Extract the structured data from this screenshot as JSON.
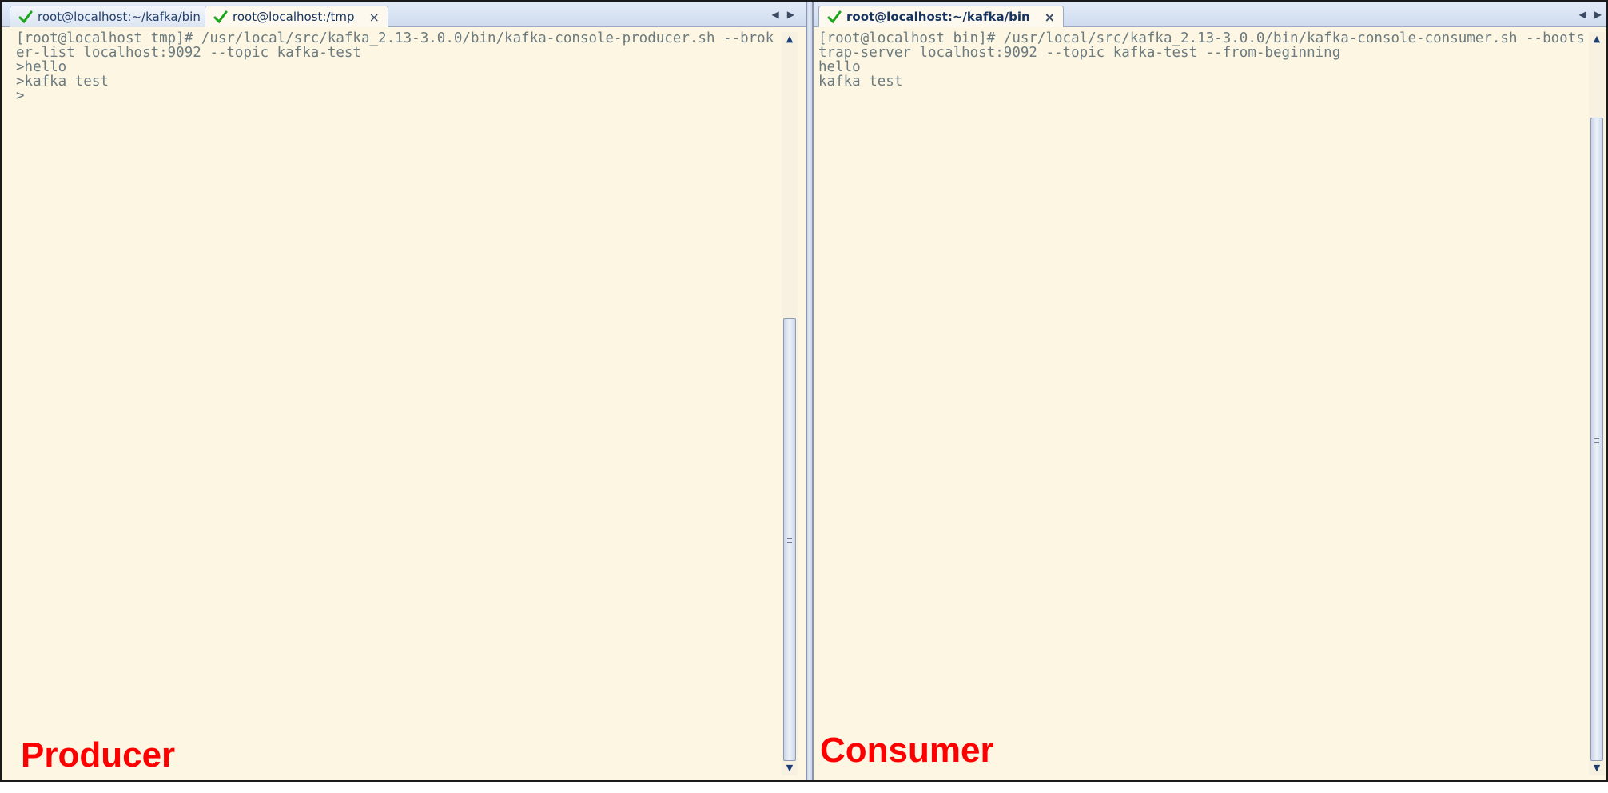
{
  "left_pane": {
    "tabs": [
      {
        "label": "root@localhost:~/kafka/bin",
        "active": false
      },
      {
        "label": "root@localhost:/tmp",
        "active": true
      }
    ],
    "close_glyph": "×",
    "nav_prev": "◀",
    "nav_next": "▶",
    "terminal_lines": [
      "[root@localhost tmp]# /usr/local/src/kafka_2.13-3.0.0/bin/kafka-console-producer.sh --brok",
      "er-list localhost:9092 --topic kafka-test",
      ">hello",
      ">kafka test",
      ">"
    ],
    "label": "Producer",
    "scroll_position": 0.35
  },
  "right_pane": {
    "tabs": [
      {
        "label": "root@localhost:~/kafka/bin",
        "active": true
      }
    ],
    "close_glyph": "×",
    "nav_prev": "◀",
    "nav_next": "▶",
    "terminal_lines": [
      "[root@localhost bin]# /usr/local/src/kafka_2.13-3.0.0/bin/kafka-console-consumer.sh --boots",
      "trap-server localhost:9092 --topic kafka-test --from-beginning",
      "hello",
      "kafka test"
    ],
    "label": "Consumer",
    "scroll_position": 0.08
  },
  "colors": {
    "terminal_bg": "#fdf6e3",
    "terminal_text": "#6b7b80",
    "label_red": "#ff0000",
    "check_green": "#1aa51a"
  },
  "icons": {
    "check": "check-icon",
    "close": "close-icon",
    "scroll_up": "▲",
    "scroll_down": "▼"
  }
}
